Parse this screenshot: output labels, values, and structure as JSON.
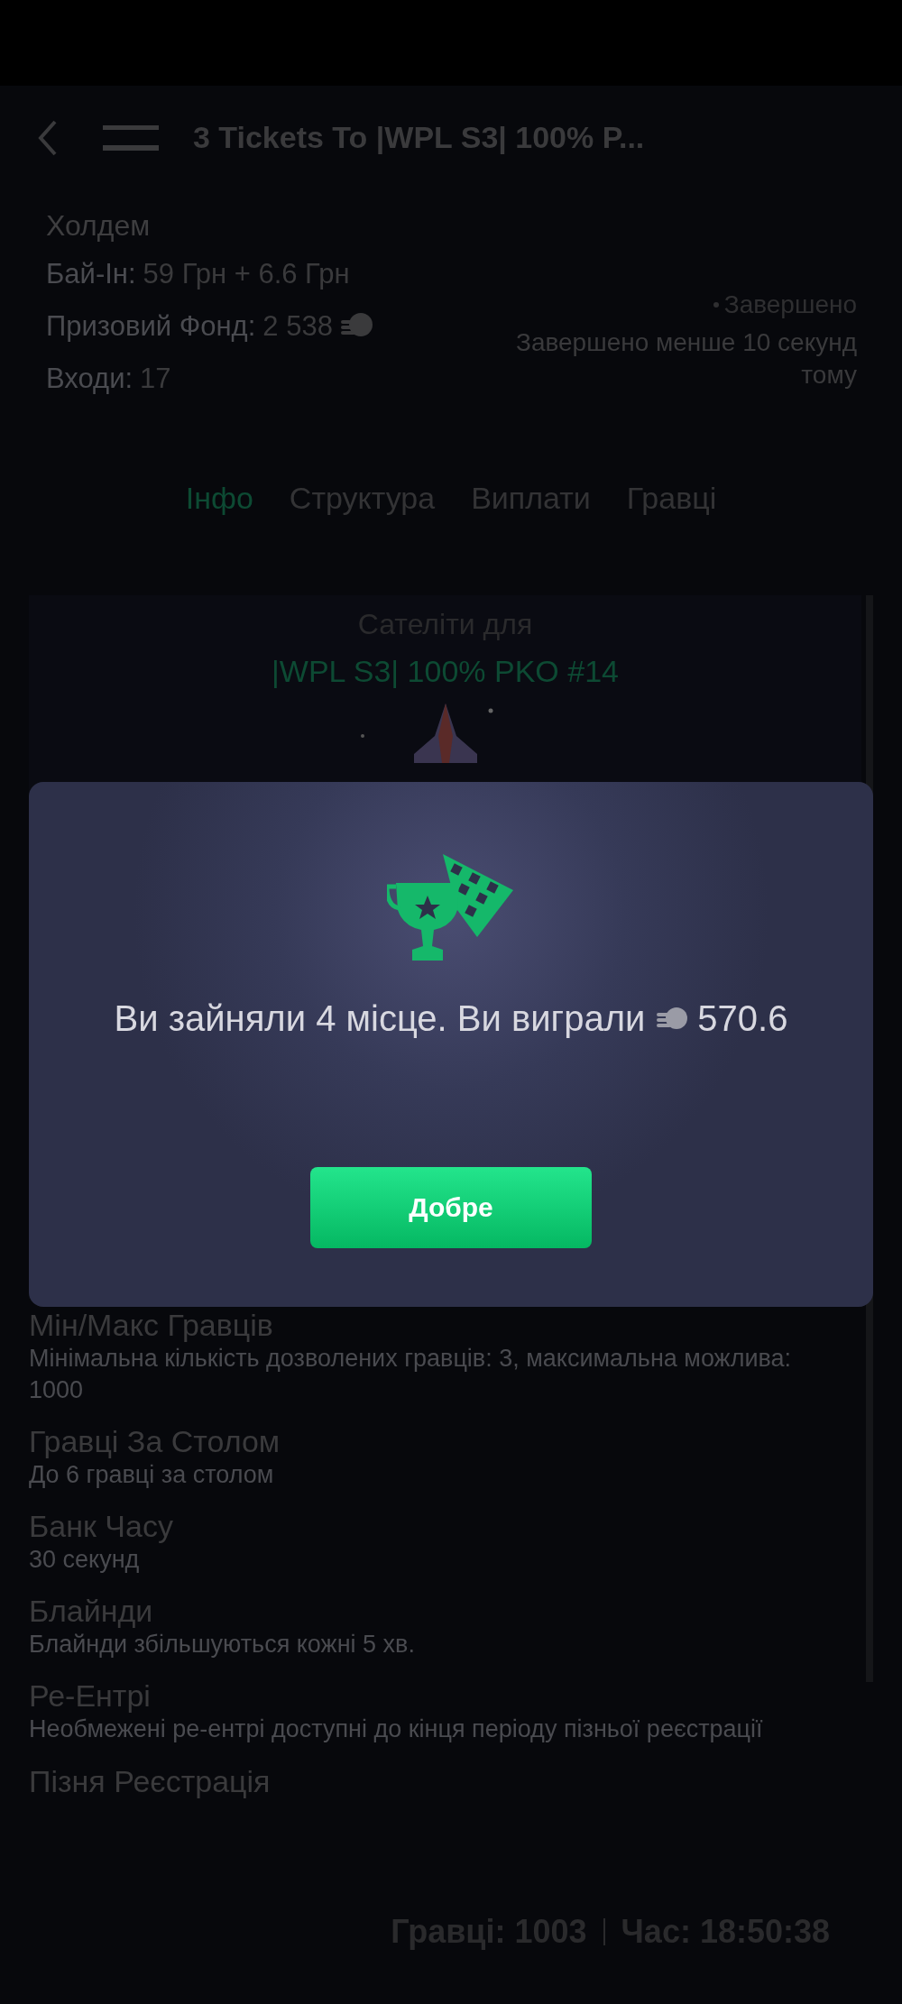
{
  "header": {
    "title": "3 Tickets To |WPL S3| 100% P..."
  },
  "info": {
    "game": "Холдем",
    "buy_in_label": "Бай-Ін:",
    "buy_in": "59 Грн + 6.6 Грн",
    "prize_label": "Призовий Фонд:",
    "prize": "2 538",
    "entries_label": "Входи:",
    "entries": "17",
    "status": "Завершено",
    "status_detail": "Завершено менше 10 секунд тому"
  },
  "tabs": [
    {
      "label": "Інфо",
      "selected": true
    },
    {
      "label": "Структура",
      "selected": false
    },
    {
      "label": "Виплати",
      "selected": false
    },
    {
      "label": "Гравці",
      "selected": false
    }
  ],
  "banner": {
    "title": "Сателіти для",
    "target": "|WPL S3| 100% PKO #14"
  },
  "details": [
    {
      "title": "Мін/Макс Гравців",
      "text": "Мінімальна кількість дозволених гравців: 3, максимальна можлива: 1000"
    },
    {
      "title": "Гравці За Столом",
      "text": "До 6 гравці за столом"
    },
    {
      "title": "Банк Часу",
      "text": "30 секунд"
    },
    {
      "title": "Блайнди",
      "text": "Блайнди збільшуються кожні 5 хв."
    },
    {
      "title": "Ре-Ентрі",
      "text": "Необмежені ре-ентрі доступні до кінця періоду пізньої реєстрації"
    },
    {
      "title": "Пізня Реєстрація"
    }
  ],
  "footer": {
    "players": "Гравці: 1003",
    "time": "Час: 18:50:38"
  },
  "dialog": {
    "message": "Ви зайняли 4 місце. Ви виграли",
    "amount": "570.6",
    "button": "Добре"
  }
}
